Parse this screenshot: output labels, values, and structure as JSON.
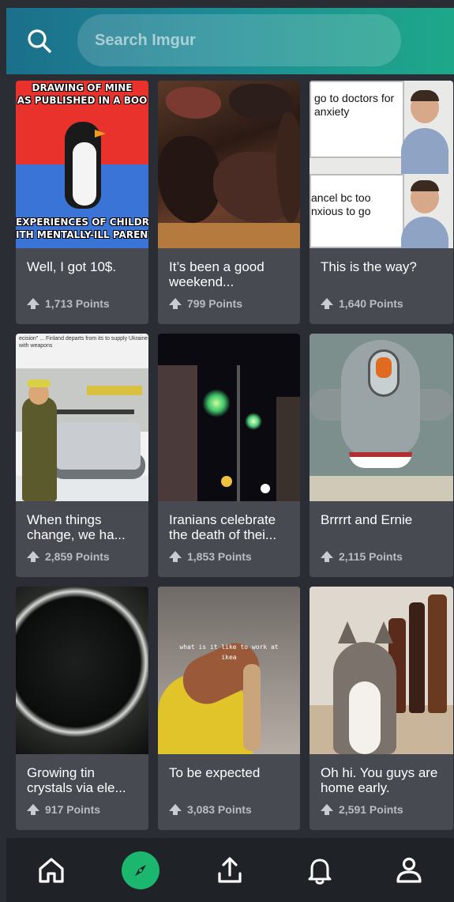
{
  "search": {
    "placeholder": "Search Imgur"
  },
  "colors": {
    "header_gradient_start": "#1b6f8a",
    "header_gradient_end": "#1ea889",
    "background": "#2a2d33",
    "card": "#474a51",
    "accent_explore": "#1bb76e"
  },
  "posts": [
    {
      "title": "Well, I got 10$.",
      "points": "1,713 Points",
      "thumb_text": {
        "top_1": "DRAWING OF MINE",
        "top_2": "AS PUBLISHED IN A BOO",
        "bottom_1": "EXPERIENCES OF CHILDRE",
        "bottom_2": "ITH MENTALLY-ILL PARENT"
      }
    },
    {
      "title": "It’s been a good weekend...",
      "points": "799 Points"
    },
    {
      "title": "This is the way?",
      "points": "1,640 Points",
      "thumb_text": {
        "top": "go to doctors for anxiety",
        "bottom": "ancel bc too nxious to go"
      }
    },
    {
      "title": "When things change, we ha...",
      "points": "2,859 Points",
      "thumb_text": {
        "headline": "ecision\" ... Finland departs from its to supply Ukraine with weapons"
      }
    },
    {
      "title": "Iranians celebrate the death of thei...",
      "points": "1,853 Points"
    },
    {
      "title": "Brrrrt and Ernie",
      "points": "2,115 Points"
    },
    {
      "title": "Growing tin crystals via ele...",
      "points": "917 Points"
    },
    {
      "title": "To be expected",
      "points": "3,083 Points",
      "thumb_text": {
        "caption": "what is it like to work at ikea"
      }
    },
    {
      "title": "Oh hi. You guys are home early.",
      "points": "2,591 Points"
    }
  ],
  "nav": {
    "items": [
      "home-icon",
      "explore-compass-icon",
      "upload-icon",
      "notifications-bell-icon",
      "profile-icon"
    ],
    "active": "explore-compass-icon"
  }
}
